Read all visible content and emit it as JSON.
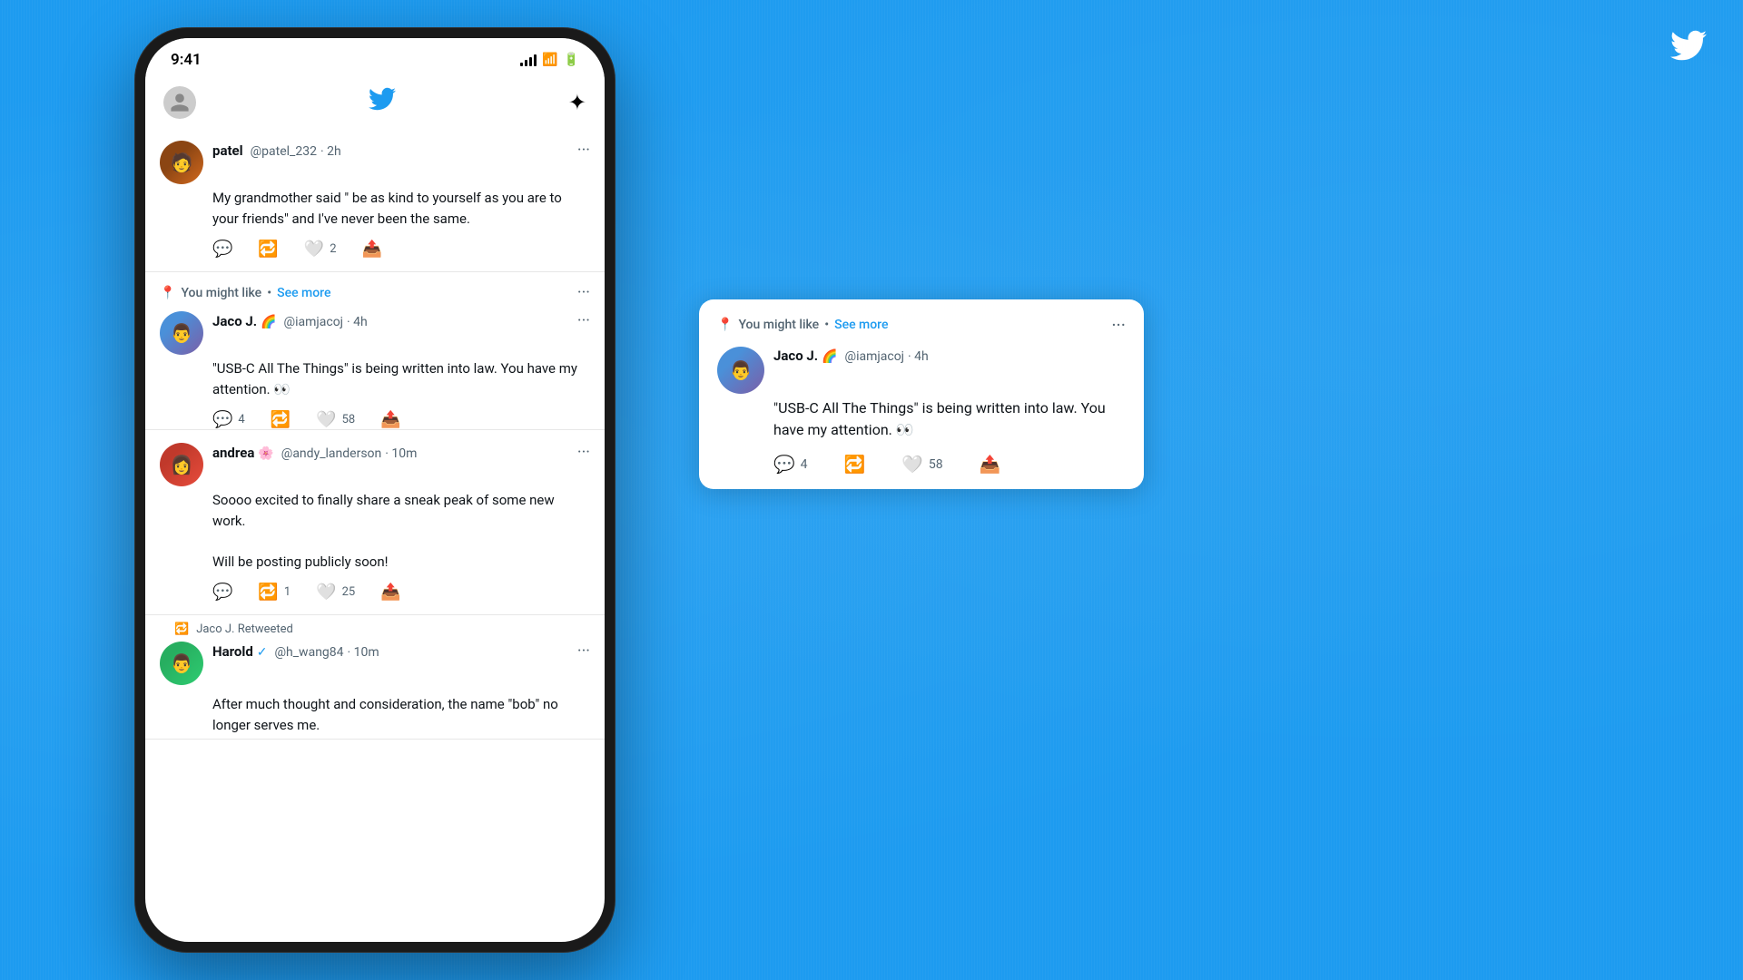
{
  "background": {
    "color": "#1d9bf0"
  },
  "twitter_corner_icon": "🐦",
  "phone": {
    "status_bar": {
      "time": "9:41",
      "signal": "signal",
      "wifi": "wifi",
      "battery": "battery"
    },
    "header": {
      "avatar_label": "user avatar",
      "twitter_icon": "🐦",
      "sparkle_icon": "✦"
    },
    "feed": {
      "tweets": [
        {
          "id": "tweet-patel",
          "avatar_emoji": "👤",
          "username": "patel",
          "handle": "@patel_232",
          "time": "2h",
          "text": "My grandmother said \" be as kind to yourself as you are to your friends\" and I've never been the same.",
          "actions": {
            "reply": "",
            "retweet": "",
            "likes": "2",
            "share": ""
          }
        }
      ],
      "you_might_like": {
        "label": "You might like",
        "dot": "•",
        "see_more": "See more",
        "tweet": {
          "id": "tweet-jaco",
          "avatar_emoji": "👤",
          "username": "Jaco J.",
          "emoji_flag": "🌈",
          "handle": "@iamjacoj",
          "time": "4h",
          "text": "\"USB-C All The Things\" is being written into law. You have my attention. 👀",
          "actions": {
            "reply_count": "4",
            "retweet": "",
            "likes": "58",
            "share": ""
          }
        }
      },
      "tweet_andrea": {
        "avatar_emoji": "👤",
        "username": "andrea",
        "emoji": "🌸",
        "handle": "@andy_landerson",
        "time": "10m",
        "text": "Soooo excited to finally share a sneak peak of some new work.\n\nWill be posting publicly soon!",
        "actions": {
          "reply": "",
          "retweet_count": "1",
          "likes": "25",
          "share": ""
        }
      },
      "retweet_label": {
        "icon": "🔁",
        "text": "Jaco J. Retweeted"
      },
      "tweet_harold": {
        "avatar_emoji": "👤",
        "username": "Harold",
        "verified": "✓",
        "handle": "@h_wang84",
        "time": "10m",
        "text": "After much thought and consideration, the name  \"bob\" no longer serves me."
      }
    }
  },
  "popup_card": {
    "you_might_like": {
      "label": "You might like",
      "dot": "•",
      "see_more": "See more"
    },
    "tweet": {
      "avatar_emoji": "👤",
      "username": "Jaco J.",
      "emoji_flag": "🌈",
      "handle": "@iamjacoj",
      "time": "4h",
      "text": "\"USB-C All The Things\" is being written into law. You have my attention. 👀",
      "actions": {
        "reply_count": "4",
        "retweet": "",
        "likes": "58",
        "share": ""
      }
    }
  }
}
